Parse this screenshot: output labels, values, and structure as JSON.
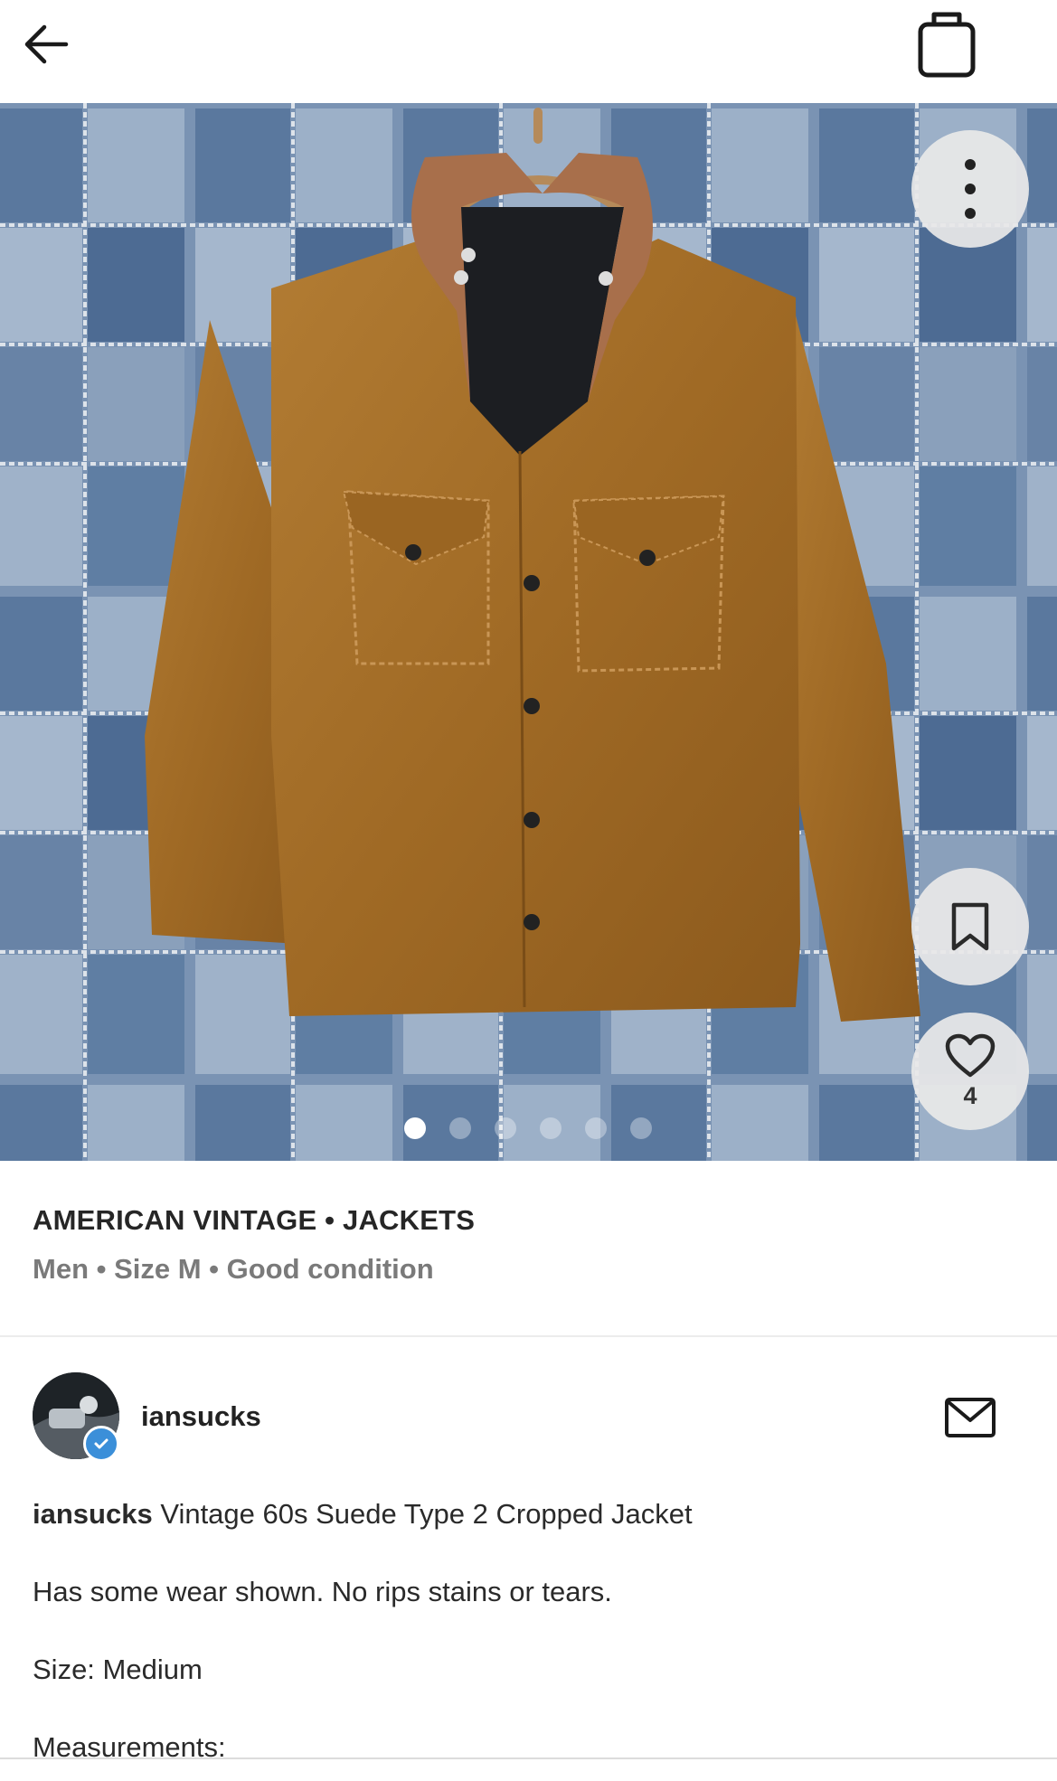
{
  "nav": {
    "back_icon": "arrow-left-icon",
    "bag_icon": "shopping-bag-icon"
  },
  "listing": {
    "brand_category": "AMERICAN VINTAGE • JACKETS",
    "meta": "Men • Size M • Good condition",
    "likes": "4",
    "photo_count": 6,
    "active_photo": 1
  },
  "seller": {
    "username": "iansucks",
    "verified": true
  },
  "description": {
    "author": "iansucks",
    "title": "Vintage 60s Suede Type 2 Cropped Jacket",
    "line2": "Has some wear shown. No rips stains or tears.",
    "line3": "Size: Medium",
    "line4": "Measurements:"
  },
  "colors": {
    "denim_dark": "#4f6e97",
    "denim_light": "#8ea3bd",
    "suede": "#a8722c",
    "collar": "#a86f4b",
    "verified_badge": "#3b8fd9"
  }
}
